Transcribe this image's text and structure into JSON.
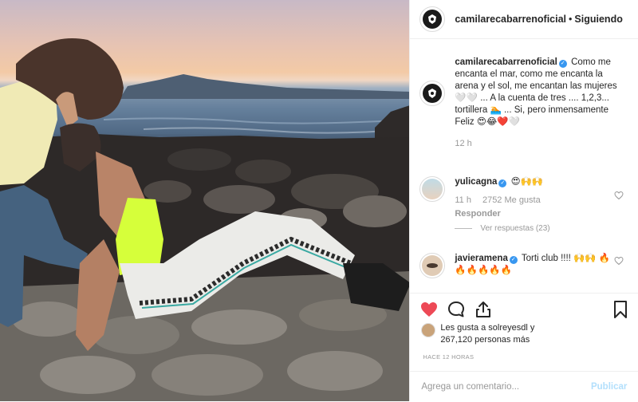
{
  "header": {
    "username": "camilarecabarrenoficial",
    "separator": "•",
    "follow_status": "Siguiendo"
  },
  "comments": [
    {
      "username": "camilarecabarrenoficial",
      "verified": true,
      "text": "Como me encanta el mar, como me encanta la arena y el sol, me encantan las mujeres 🤍🤍 ... A la cuenta de tres .... 1,2,3... tortillera 🏊 ... Si, pero inmensamente Feliz 😍😂❤️🤍",
      "time": "12 h"
    },
    {
      "username": "yulicagna",
      "verified": true,
      "text": "😍🙌🙌",
      "time": "11 h",
      "likes": "2752 Me gusta",
      "reply_label": "Responder",
      "view_replies": "Ver respuestas (23)"
    },
    {
      "username": "javieramena",
      "verified": true,
      "text": "Torti club !!!! 🙌🙌 🔥🔥🔥🔥🔥🔥"
    }
  ],
  "likes": {
    "line1": "Les gusta a solreyesdl y",
    "line2": "267,120 personas más"
  },
  "timestamp": "HACE 12 HORAS",
  "add_comment": {
    "placeholder": "Agrega un comentario...",
    "publish_label": "Publicar"
  },
  "icons": {
    "like": "heart-icon",
    "comment": "comment-icon",
    "share": "share-icon",
    "save": "bookmark-icon"
  },
  "colors": {
    "like_active": "#ed4956",
    "verified": "#3897f0",
    "muted_text": "#999999",
    "publish_disabled": "#b2dffc",
    "neon_top": "#d6ff3a"
  }
}
